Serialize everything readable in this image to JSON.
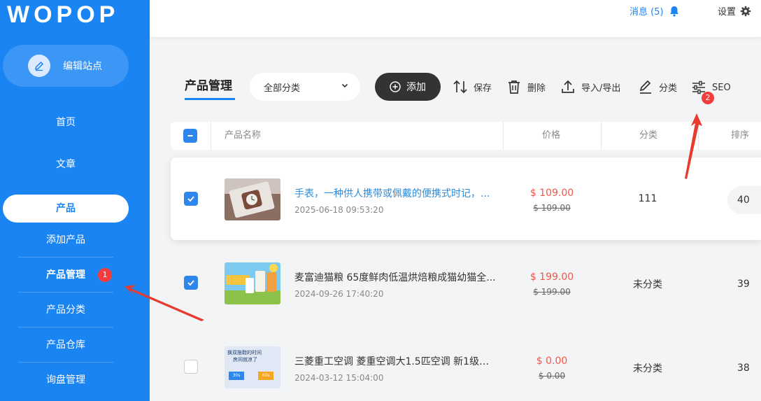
{
  "sidebar": {
    "logo": "WOPOP",
    "edit_site": "编辑站点",
    "nav": [
      "首页",
      "文章",
      "产品"
    ],
    "sub": [
      "添加产品",
      "产品管理",
      "产品分类",
      "产品仓库",
      "询盘管理"
    ],
    "badge": "1"
  },
  "header": {
    "messages": "消息 (5)",
    "settings": "设置"
  },
  "toolbar": {
    "title": "产品管理",
    "category": "全部分类",
    "add": "添加",
    "save": "保存",
    "delete": "删除",
    "import_export": "导入/导出",
    "classify": "分类",
    "seo": "SEO",
    "badge": "2"
  },
  "table": {
    "columns": [
      "产品名称",
      "价格",
      "分类",
      "排序"
    ],
    "rows": [
      {
        "name": "手表，一种供人携带或佩戴的便携式时记，...",
        "date": "2025-06-18 09:53:20",
        "price": "$ 109.00",
        "original": "$ 109.00",
        "category": "111",
        "sort": "40",
        "checked": true
      },
      {
        "name": "麦富迪猫粮 65度鲜肉低温烘焙粮成猫幼猫全...",
        "date": "2024-09-26 17:40:20",
        "price": "$ 199.00",
        "original": "$ 199.00",
        "category": "未分类",
        "sort": "39",
        "checked": true
      },
      {
        "name": "三菱重工空调 菱重空调大1.5匹空调 新1级能...",
        "date": "2024-03-12 15:04:00",
        "price": "$ 0.00",
        "original": "$ 0.00",
        "category": "未分类",
        "sort": "38",
        "checked": false
      }
    ],
    "thumb3_text": [
      "换双拖鞋的时间",
      "房间就凉了",
      "30s",
      "60s"
    ]
  },
  "colors": {
    "sidebar": "#1a84f3",
    "accent": "#2e86ec",
    "price": "#f0574a",
    "badge": "#f33d3d"
  }
}
